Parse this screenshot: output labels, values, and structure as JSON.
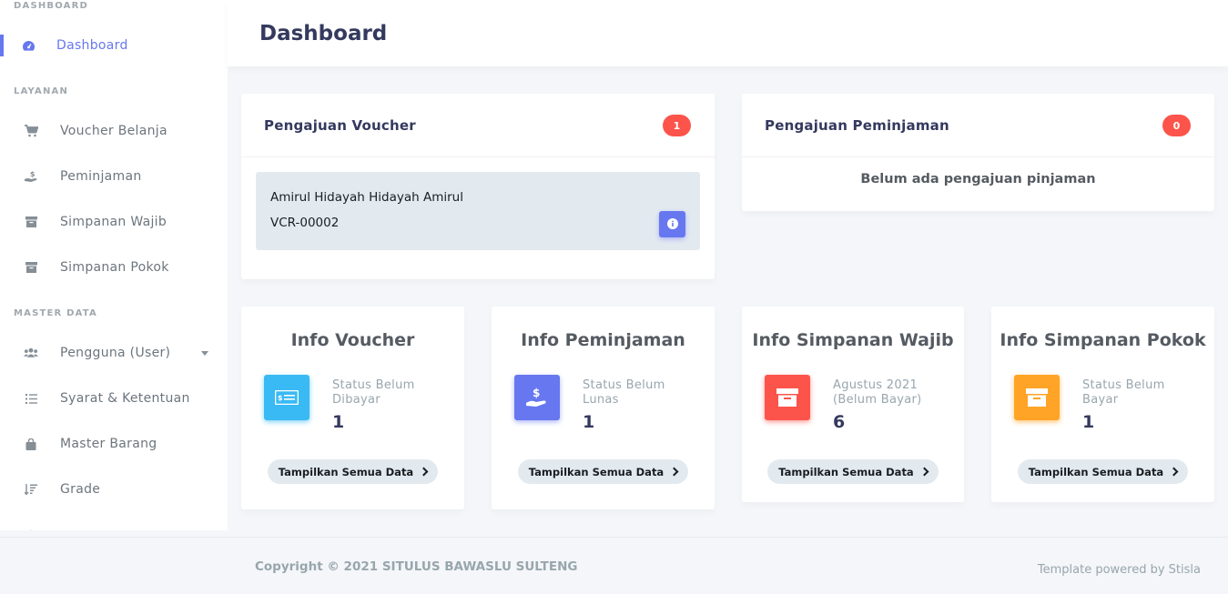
{
  "sidebar": {
    "header_dashboard": "DASHBOARD",
    "dashboard": "Dashboard",
    "header_layanan": "LAYANAN",
    "voucher_belanja": "Voucher Belanja",
    "peminjaman": "Peminjaman",
    "simpanan_wajib": "Simpanan Wajib",
    "simpanan_pokok": "Simpanan Pokok",
    "header_master": "MASTER DATA",
    "pengguna": "Pengguna (User)",
    "syarat": "Syarat & Ketentuan",
    "master_barang": "Master Barang",
    "grade": "Grade"
  },
  "header": {
    "title": "Dashboard"
  },
  "pengajuan_voucher": {
    "title": "Pengajuan Voucher",
    "count": "1",
    "item": {
      "name": "Amirul Hidayah Hidayah Amirul",
      "code": "VCR-00002"
    }
  },
  "pengajuan_peminjaman": {
    "title": "Pengajuan Peminjaman",
    "count": "0",
    "empty": "Belum ada pengajuan pinjaman"
  },
  "stats": [
    {
      "title": "Info Voucher",
      "label": "Status Belum Dibayar",
      "value": "1",
      "button": "Tampilkan Semua Data",
      "color": "#3abaf4",
      "icon": "ticket-icon"
    },
    {
      "title": "Info Peminjaman",
      "label": "Status Belum Lunas",
      "value": "1",
      "button": "Tampilkan Semua Data",
      "color": "#6777ef",
      "icon": "hand-dollar-icon"
    },
    {
      "title": "Info Simpanan Wajib",
      "label": "Agustus 2021 (Belum Bayar)",
      "value": "6",
      "button": "Tampilkan Semua Data",
      "color": "#fc544b",
      "icon": "archive-icon"
    },
    {
      "title": "Info Simpanan Pokok",
      "label": "Status Belum Bayar",
      "value": "1",
      "button": "Tampilkan Semua Data",
      "color": "#ffa426",
      "icon": "archive-icon"
    }
  ],
  "footer": {
    "copyright": "Copyright © 2021 SITULUS BAWASLU SULTENG",
    "powered": "Template powered by Stisla"
  }
}
